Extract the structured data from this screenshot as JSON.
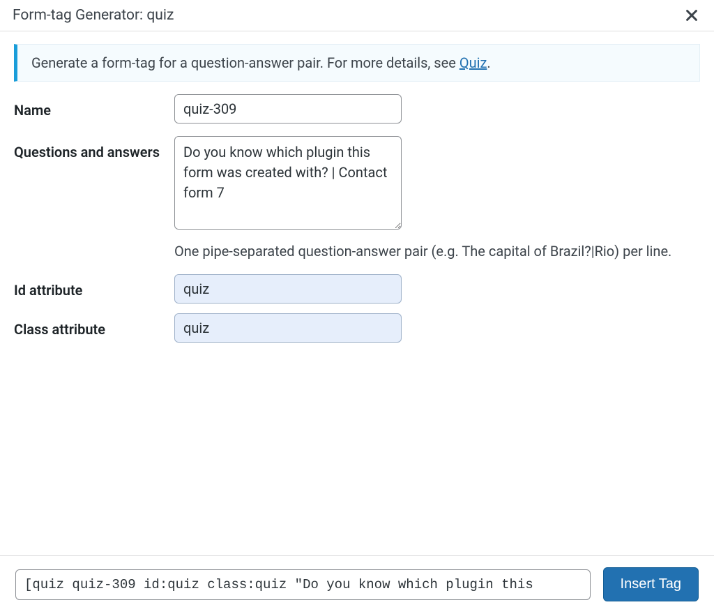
{
  "header": {
    "title": "Form-tag Generator: quiz"
  },
  "notice": {
    "text_before_link": "Generate a form-tag for a question-answer pair. For more details, see ",
    "link_text": "Quiz",
    "text_after_link": "."
  },
  "form": {
    "name": {
      "label": "Name",
      "value": "quiz-309"
    },
    "qa": {
      "label": "Questions and answers",
      "value": "Do you know which plugin this form was created with? | Contact form 7",
      "hint": "One pipe-separated question-answer pair (e.g. The capital of Brazil?|Rio) per line."
    },
    "id_attr": {
      "label": "Id attribute",
      "value": "quiz"
    },
    "class_attr": {
      "label": "Class attribute",
      "value": "quiz"
    }
  },
  "footer": {
    "generated_tag": "[quiz quiz-309 id:quiz class:quiz \"Do you know which plugin this ",
    "insert_label": "Insert Tag"
  }
}
